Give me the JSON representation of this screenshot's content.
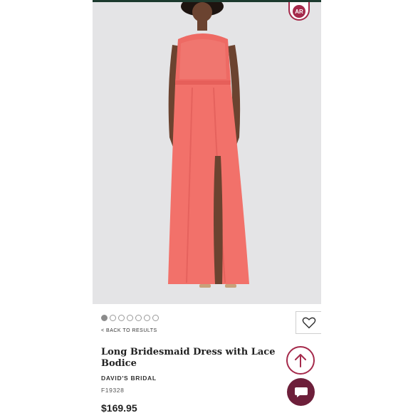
{
  "ar_badge": {
    "label": "AR",
    "icon": "ar-view-icon"
  },
  "gallery": {
    "image_count": 7,
    "active_index": 0
  },
  "nav": {
    "back_label": "< BACK TO RESULTS"
  },
  "product": {
    "title": "Long Bridesmaid Dress with Lace Bodice",
    "brand": "DAVID'S BRIDAL",
    "sku": "F19328",
    "price": "$169.95"
  },
  "icons": {
    "favorite": "heart-icon",
    "scroll_top": "arrow-up-icon",
    "chat": "chat-bubble-icon"
  },
  "colors": {
    "brand_accent": "#a52a4b",
    "chat_bg": "#6d1f3a",
    "dress": "#f2716a",
    "background": "#e4e4e6"
  }
}
